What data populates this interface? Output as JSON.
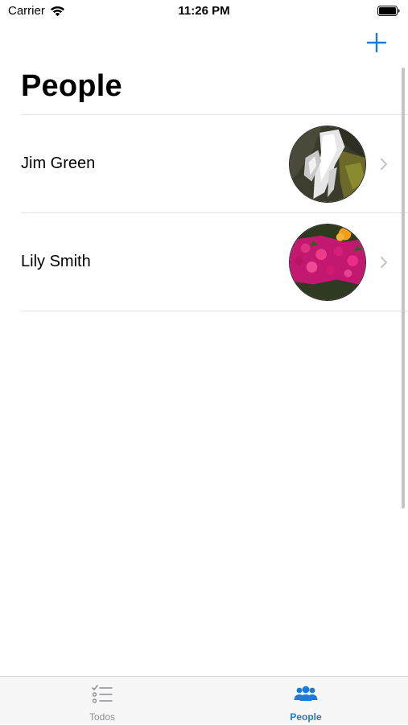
{
  "status_bar": {
    "carrier": "Carrier",
    "time": "11:26 PM",
    "icons": [
      "wifi-icon",
      "battery-icon"
    ]
  },
  "nav": {
    "title": "People",
    "add_icon": "plus-icon",
    "accent_color": "#1a7bdc"
  },
  "people": [
    {
      "name": "Jim Green",
      "avatar": "waterfall-photo"
    },
    {
      "name": "Lily Smith",
      "avatar": "pink-flowers-photo"
    }
  ],
  "tab_bar": {
    "tabs": [
      {
        "label": "Todos",
        "icon": "checklist-icon",
        "selected": false
      },
      {
        "label": "People",
        "icon": "people-group-icon",
        "selected": true
      }
    ],
    "selected_color": "#1a7bdc",
    "unselected_color": "#8e8e93"
  }
}
